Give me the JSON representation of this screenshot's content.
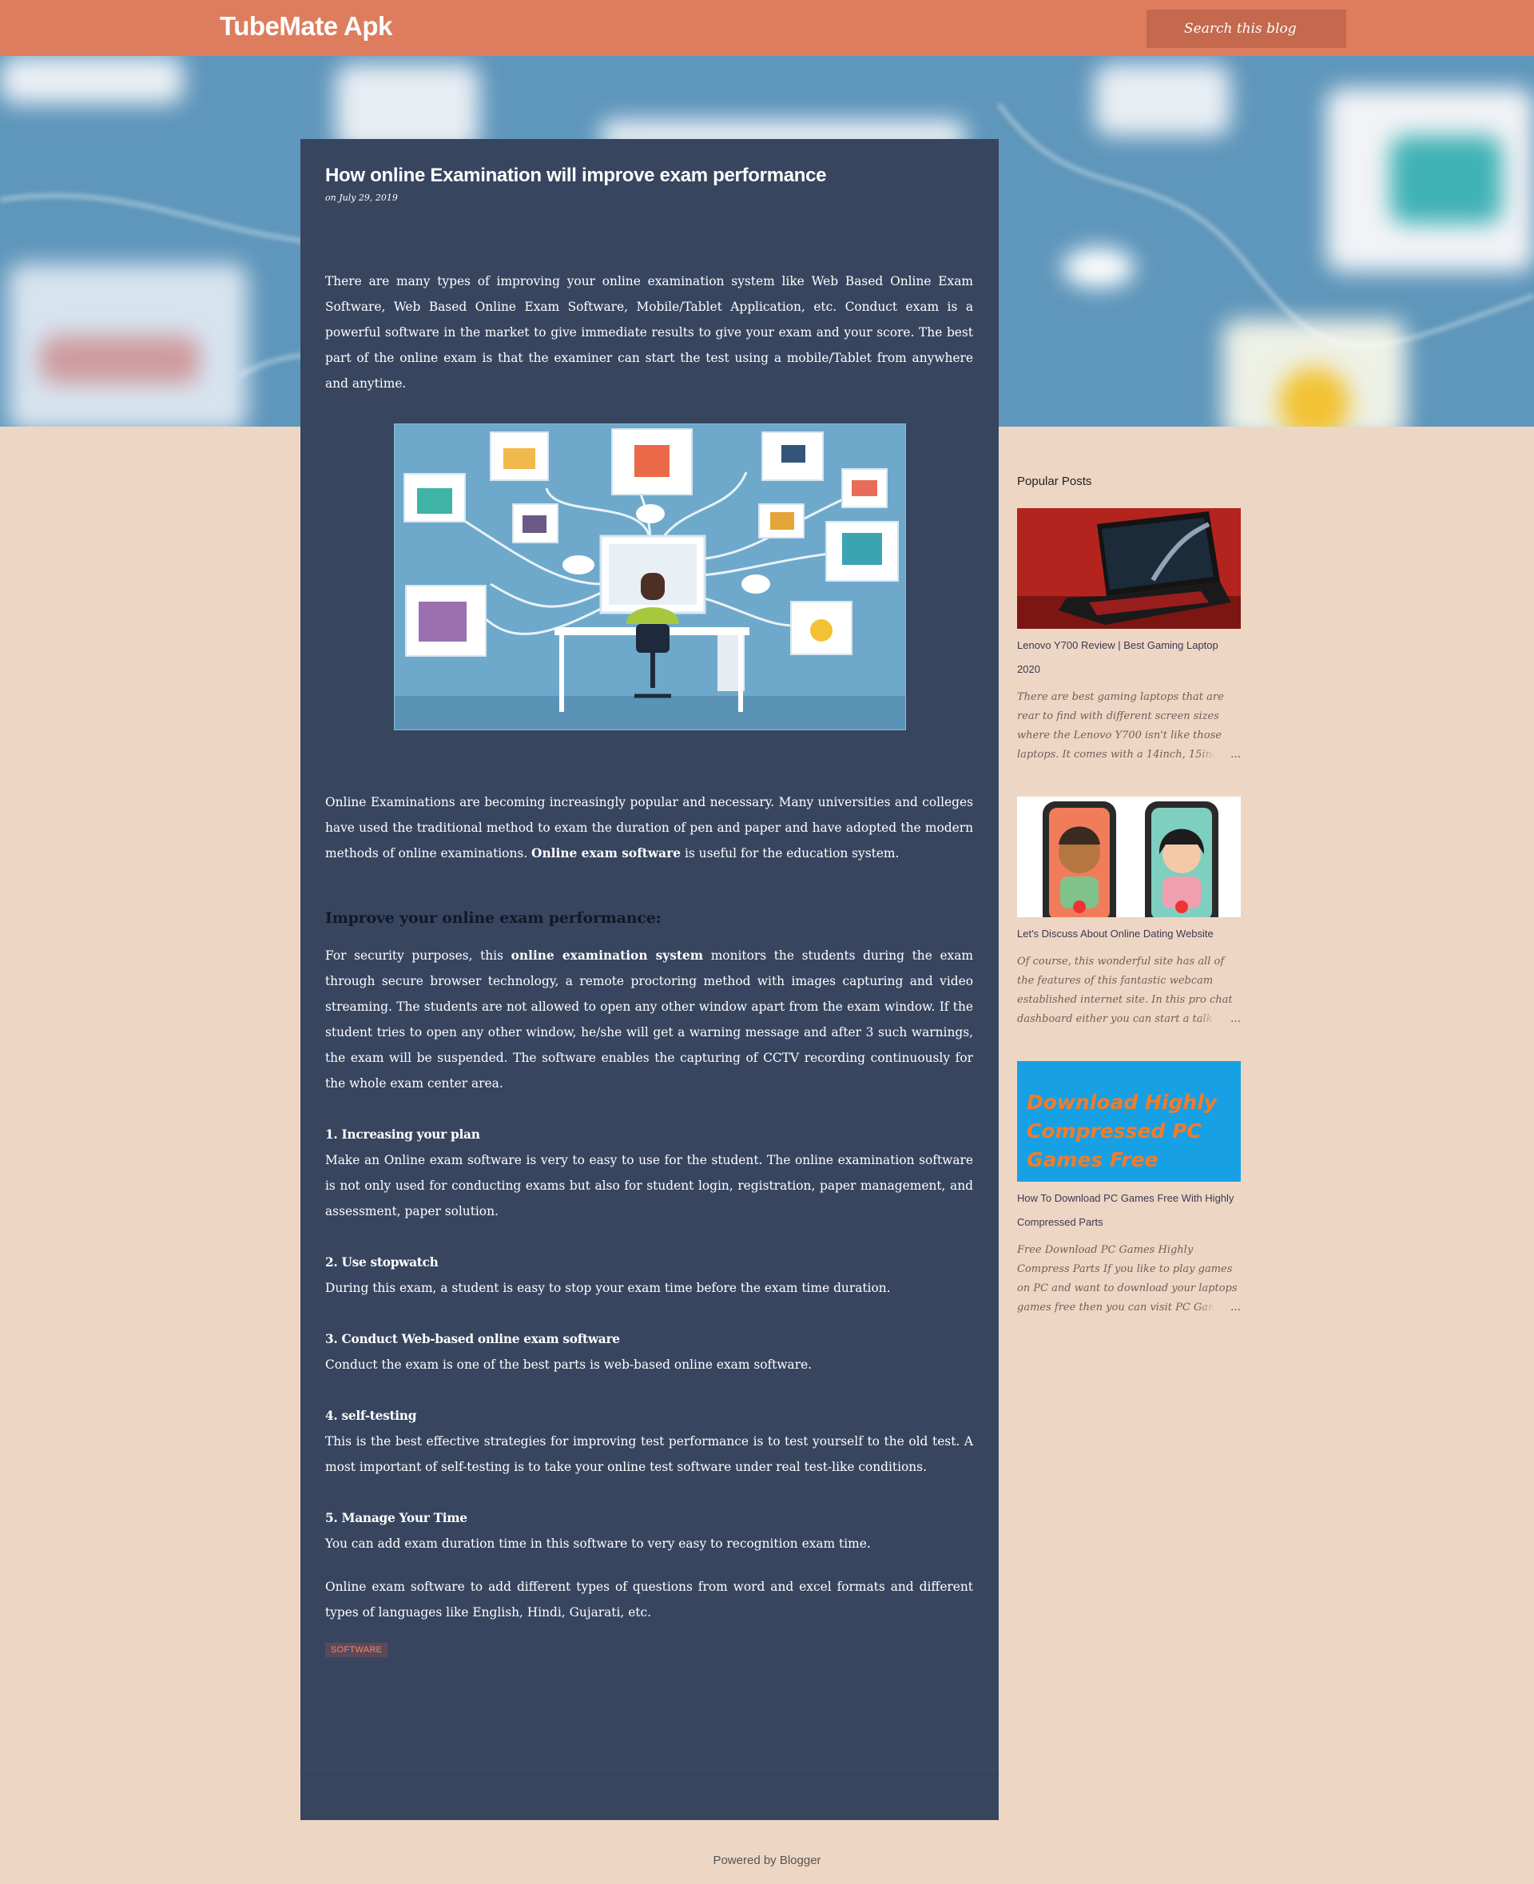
{
  "header": {
    "site_title": "TubeMate Apk",
    "search_placeholder": "Search this blog"
  },
  "post": {
    "title": "How online Examination will improve exam performance",
    "date": "on July 29, 2019",
    "intro": "There are many types of improving your online examination system like Web Based Online Exam Software, Web Based Online Exam Software, Mobile/Tablet Application, etc. Conduct exam is a powerful software in the market to give immediate results to give your exam and your score. The best part of the online exam is that the examiner can start the test using a mobile/Tablet from anywhere and anytime.",
    "para2_a": "Online Examinations are becoming increasingly popular and necessary. Many universities and colleges have used the traditional method to exam the duration of pen and paper and have adopted the modern methods of online examinations. ",
    "para2_bold": "Online exam software",
    "para2_b": " is useful for the education system.",
    "heading": "Improve your online exam performance:",
    "para3_a": "For security purposes, this ",
    "para3_bold": "online examination system",
    "para3_b": " monitors the students during the exam through secure browser technology, a remote proctoring method with images capturing and video streaming. The students are not allowed to open any other window apart from the exam window. If the student tries to open any other window, he/she will get a warning message and after 3 such warnings, the exam will be suspended. The software enables the capturing of CCTV recording continuously for the whole exam center area.",
    "sections": [
      {
        "title": "1. Increasing your plan",
        "body": "Make an Online exam software is very to easy to use for the student. The online examination software is not only used for conducting exams but also for student login, registration, paper management, and assessment, paper solution."
      },
      {
        "title": "2. Use stopwatch",
        "body": "During this exam, a student is easy to stop your exam time before the exam time duration."
      },
      {
        "title": "3. Conduct  Web-based online  exam software",
        "body": "Conduct the exam is one of the best parts is web-based online exam software."
      },
      {
        "title": "4. self-testing",
        "body": "This is the best effective strategies for improving test performance is to test yourself to the old test. A most important of self-testing is to take your online test software under real test-like conditions."
      },
      {
        "title": "5. Manage Your Time",
        "body": "You can add exam duration time in this software to very easy to recognition exam time."
      }
    ],
    "closing": "Online exam software to add different types of questions from word and excel formats and different types of languages like English, Hindi, Gujarati, etc.",
    "label": "SOFTWARE"
  },
  "sidebar": {
    "widget_title": "Popular Posts",
    "posts": [
      {
        "title": "Lenovo Y700 Review | Best Gaming Laptop 2020",
        "snippet": "There are best gaming laptops that are rear to find with different screen sizes where the Lenovo Y700 isn't like those laptops. It comes with a 14inch, 15inch,",
        "more": "…"
      },
      {
        "title": "Let's Discuss About Online Dating Website",
        "snippet": "Of course, this wonderful site has all of the features of this fantastic webcam established internet site. In this pro chat dashboard either you can start a talk w",
        "more": "…"
      },
      {
        "title": "How To Download PC Games Free With Highly Compressed Parts",
        "snippet": "Free Download PC Games Highly Compress Parts If you like to play games on PC and want to download your laptops games free then you can visit PC Game",
        "more": "…",
        "thumb_text": "Download Highly Compressed PC Games Free"
      }
    ]
  },
  "footer": {
    "text": "Powered by Blogger"
  }
}
